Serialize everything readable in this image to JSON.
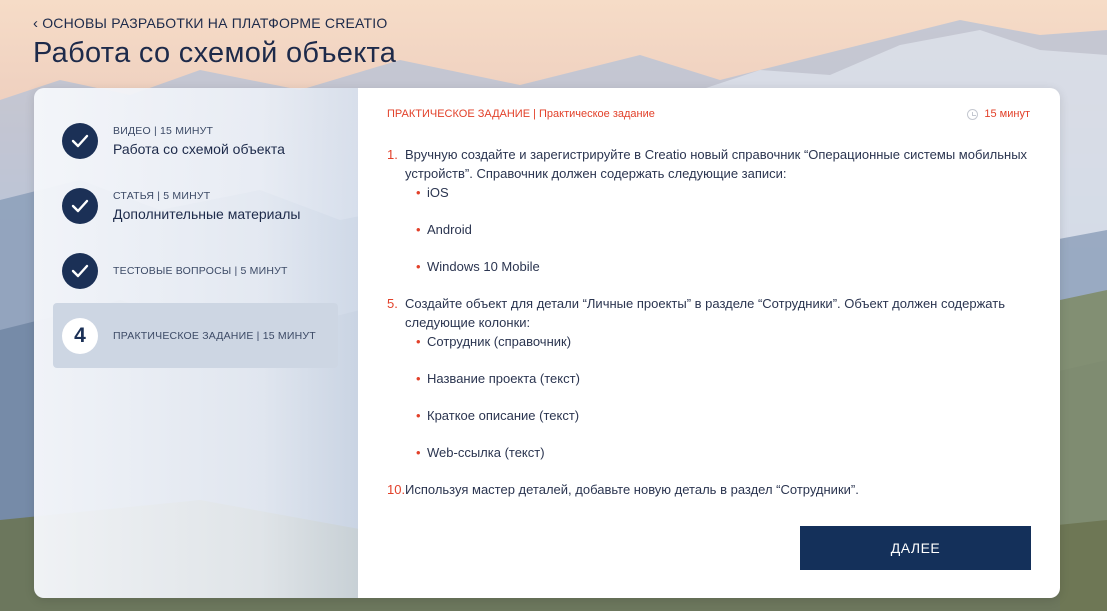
{
  "breadcrumb": {
    "label": "ОСНОВЫ РАЗРАБОТКИ НА ПЛАТФОРМЕ CREATIO"
  },
  "page": {
    "title": "Работа со схемой объекта"
  },
  "steps": [
    {
      "meta": "ВИДЕО | 15 МИНУТ",
      "title": "Работа со схемой объекта",
      "status": "done"
    },
    {
      "meta": "СТАТЬЯ | 5 МИНУТ",
      "title": "Дополнительные материалы",
      "status": "done"
    },
    {
      "meta": "ТЕСТОВЫЕ ВОПРОСЫ | 5 МИНУТ",
      "title": "",
      "status": "done"
    },
    {
      "number": "4",
      "meta": "ПРАКТИЧЕСКОЕ ЗАДАНИЕ | 15 МИНУТ",
      "title": "",
      "status": "active"
    }
  ],
  "content": {
    "section_label": "ПРАКТИЧЕСКОЕ ЗАДАНИЕ | Практическое задание",
    "duration": "15 минут",
    "tasks": [
      {
        "number": "1.",
        "text": "Вручную создайте и зарегистрируйте в Creatio новый справочник “Операционные системы мобильных устройств”. Справочник должен содержать следующие записи:",
        "items": [
          "iOS",
          "Android",
          "Windows 10 Mobile"
        ]
      },
      {
        "number": "5.",
        "text": "Создайте объект для детали “Личные проекты” в разделе “Сотрудники”. Объект должен содержать следующие колонки:",
        "items": [
          "Сотрудник (справочник)",
          "Название проекта (текст)",
          "Краткое описание (текст)",
          "Web-ссылка (текст)"
        ]
      },
      {
        "number": "10.",
        "text": "Используя мастер деталей, добавьте новую деталь в раздел “Сотрудники”.",
        "items": []
      }
    ],
    "next_label": "ДАЛЕЕ"
  },
  "colors": {
    "accent": "#e2412a",
    "primary": "#14305a",
    "active_step_bg": "#cdd6e3"
  },
  "icons": {
    "done": "check-icon",
    "back": "chevron-left-icon",
    "duration": "clock-icon"
  }
}
